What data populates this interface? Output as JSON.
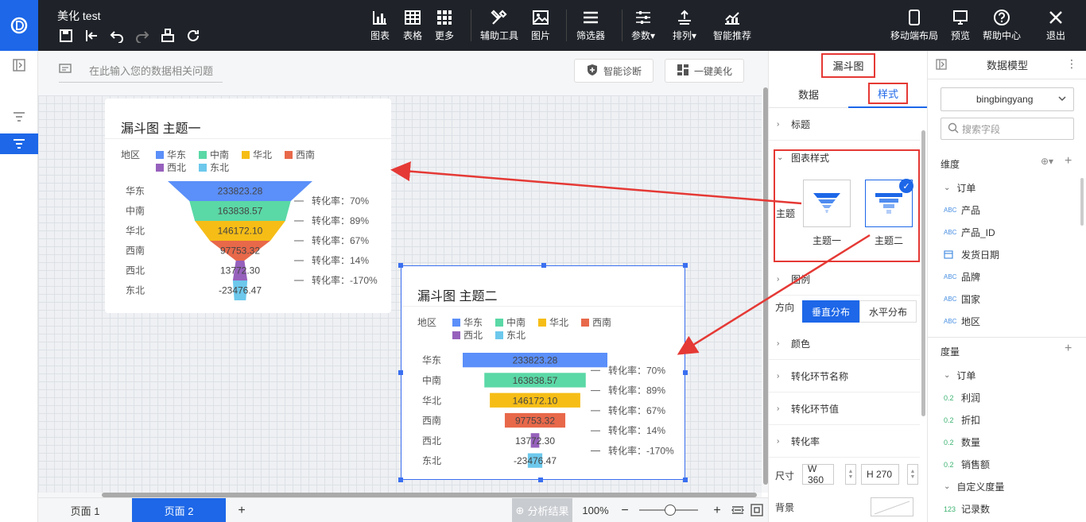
{
  "app": {
    "title": "美化 test"
  },
  "toolbar": {
    "items": [
      {
        "label": "图表",
        "icon": "bar-chart-icon"
      },
      {
        "label": "表格",
        "icon": "table-icon"
      },
      {
        "label": "更多",
        "icon": "grid-more-icon"
      },
      {
        "label": "辅助工具",
        "icon": "tools-icon"
      },
      {
        "label": "图片",
        "icon": "image-icon"
      },
      {
        "label": "筛选器",
        "icon": "filter-list-icon"
      },
      {
        "label": "参数▾",
        "icon": "sliders-icon"
      },
      {
        "label": "排列▾",
        "icon": "arrange-icon"
      },
      {
        "label": "智能推荐",
        "icon": "trend-chart-icon"
      }
    ],
    "right": [
      {
        "label": "移动端布局",
        "icon": "phone-icon"
      },
      {
        "label": "预览",
        "icon": "preview-icon"
      },
      {
        "label": "帮助中心",
        "icon": "help-icon"
      },
      {
        "label": "退出",
        "icon": "close-icon"
      }
    ]
  },
  "query": {
    "placeholder": "在此输入您的数据相关问题",
    "diagnose": "智能诊断",
    "beautify": "一键美化"
  },
  "chart1": {
    "title": "漏斗图 主题一"
  },
  "chart2": {
    "title": "漏斗图 主题二"
  },
  "chart_data": [
    {
      "type": "funnel",
      "title": "漏斗图 主题一",
      "legend_title": "地区",
      "categories": [
        "华东",
        "中南",
        "华北",
        "西南",
        "西北",
        "东北"
      ],
      "values": [
        233823.28,
        163838.57,
        146172.1,
        97753.32,
        13772.3,
        -23476.47
      ],
      "value_labels": [
        "233823.28",
        "163838.57",
        "146172.10",
        "97753.32",
        "13772.30",
        "-23476.47"
      ],
      "conversion_labels": [
        "转化率：70%",
        "转化率：89%",
        "转化率：67%",
        "转化率：14%",
        "转化率：-170%"
      ],
      "colors": [
        "#5b8ff9",
        "#5ad8a6",
        "#f6bd16",
        "#e8684a",
        "#9661bc",
        "#6dc8ec"
      ]
    },
    {
      "type": "funnel",
      "title": "漏斗图 主题二",
      "legend_title": "地区",
      "categories": [
        "华东",
        "中南",
        "华北",
        "西南",
        "西北",
        "东北"
      ],
      "values": [
        233823.28,
        163838.57,
        146172.1,
        97753.32,
        13772.3,
        -23476.47
      ],
      "value_labels": [
        "233823.28",
        "163838.57",
        "146172.10",
        "97753.32",
        "13772.30",
        "-23476.47"
      ],
      "conversion_labels": [
        "转化率：70%",
        "转化率：89%",
        "转化率：67%",
        "转化率：14%",
        "转化率：-170%"
      ],
      "colors": [
        "#5b8ff9",
        "#5ad8a6",
        "#f6bd16",
        "#e8684a",
        "#9661bc",
        "#6dc8ec"
      ]
    }
  ],
  "pages": {
    "tab1": "页面 1",
    "tab2": "页面 2",
    "add": "+",
    "analysis": "分析结果",
    "zoom": "100%",
    "minus": "−",
    "plus": "+"
  },
  "panel": {
    "chart_type": "漏斗图",
    "tab_data": "数据",
    "tab_style": "样式",
    "sections": {
      "title": "标题",
      "chart_style": "图表样式",
      "legend": "图例",
      "color": "颜色",
      "step_name": "转化环节名称",
      "step_value": "转化环节值",
      "rate": "转化率"
    },
    "theme_label": "主题",
    "theme1": "主题一",
    "theme2": "主题二",
    "direction_label": "方向",
    "dir_vertical": "垂直分布",
    "dir_horizontal": "水平分布",
    "size_label": "尺寸",
    "width": "W 360",
    "height": "H 270",
    "bg_label": "背景"
  },
  "model": {
    "title": "数据模型",
    "dataset": "bingbingyang",
    "search_placeholder": "搜索字段",
    "dimension_label": "维度",
    "measure_label": "度量",
    "dim_group": "订单",
    "dimensions": [
      {
        "tag": "ABC",
        "name": "产品"
      },
      {
        "tag": "ABC",
        "name": "产品_ID"
      },
      {
        "tag": "date",
        "name": "发货日期"
      },
      {
        "tag": "ABC",
        "name": "品牌"
      },
      {
        "tag": "ABC",
        "name": "国家"
      },
      {
        "tag": "ABC",
        "name": "地区"
      }
    ],
    "measure_group": "订单",
    "measures": [
      {
        "tag": "0.2",
        "name": "利润"
      },
      {
        "tag": "0.2",
        "name": "折扣"
      },
      {
        "tag": "0.2",
        "name": "数量"
      },
      {
        "tag": "0.2",
        "name": "销售额"
      }
    ],
    "custom_group": "自定义度量",
    "custom": [
      {
        "tag": "123",
        "name": "记录数"
      }
    ]
  }
}
